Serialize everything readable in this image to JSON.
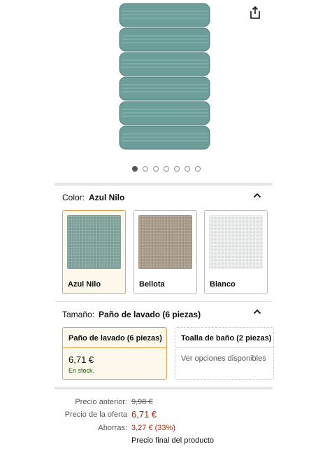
{
  "gallery": {
    "image_alt": "Toallas Azul Nilo apiladas",
    "dot_count": 7,
    "active_dot": 0
  },
  "color_section": {
    "label": "Color:",
    "value": "Azul Nilo",
    "swatches": [
      {
        "label": "Azul Nilo",
        "color": "#7fa39c",
        "selected": true
      },
      {
        "label": "Bellota",
        "color": "#a89a88",
        "selected": false
      },
      {
        "label": "Blanco",
        "color": "#eceeee",
        "selected": false
      }
    ]
  },
  "size_section": {
    "label": "Tamaño:",
    "value": "Paño de lavado (6 piezas)",
    "options": [
      {
        "title": "Paño de lavado (6 piezas)",
        "price": "6,71 €",
        "stock": "En stock.",
        "selected": true
      },
      {
        "title": "Toalla de baño (2 piezas)",
        "note": "Ver opciones disponibles",
        "selected": false
      }
    ]
  },
  "pricing": {
    "previous_label": "Precio anterior:",
    "previous_value": "9,98 €",
    "offer_label": "Precio de la oferta",
    "offer_value": "6,71 €",
    "savings_label": "Ahorras:",
    "savings_value": "3,27 € (33%)",
    "final_note": "Precio final del producto"
  },
  "colors": {
    "towel": "#6e9e9a",
    "accent_border": "#e7a34a",
    "price_red": "#b12704",
    "stock_green": "#007600"
  }
}
